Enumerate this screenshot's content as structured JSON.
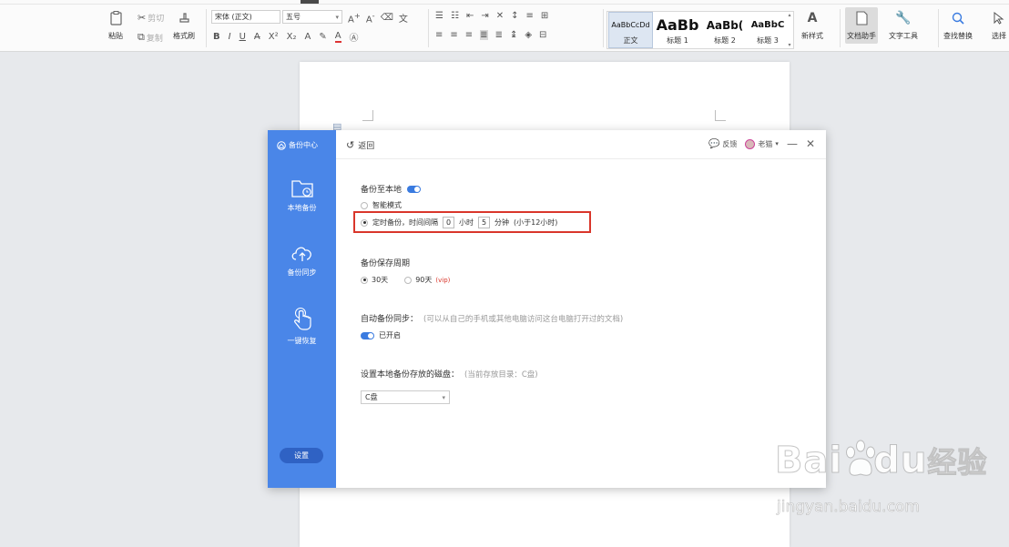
{
  "ribbon": {
    "clipboard": {
      "paste": "粘贴",
      "cut": "剪切",
      "copy": "复制",
      "format_painter": "格式刷"
    },
    "font": {
      "family": "宋体 (正文)",
      "size": "五号"
    },
    "styles": [
      {
        "preview": "AaBbCcDd",
        "name": "正文",
        "selected": true
      },
      {
        "preview": "AaBb",
        "name": "标题 1"
      },
      {
        "preview": "AaBb(",
        "name": "标题 2"
      },
      {
        "preview": "AaBbC",
        "name": "标题 3"
      }
    ],
    "new_style": "新样式",
    "doc_assistant": "文档助手",
    "text_tools": "文字工具",
    "find_replace": "查找替换",
    "select": "选择"
  },
  "dialog": {
    "sidebar": {
      "title": "备份中心",
      "items": [
        {
          "label": "本地备份",
          "icon": "folder-clock-icon"
        },
        {
          "label": "备份同步",
          "icon": "cloud-upload-icon"
        },
        {
          "label": "一键恢复",
          "icon": "hand-pointer-icon"
        }
      ],
      "settings": "设置"
    },
    "back": "返回",
    "feedback": "反馈",
    "user": "老猫",
    "local_backup": {
      "title": "备份至本地",
      "enabled": true,
      "smart_mode": "智能模式",
      "timed_prefix": "定时备份，时间间隔",
      "hours_value": "0",
      "hours_unit": "小时",
      "minutes_value": "5",
      "minutes_unit": "分钟",
      "timed_suffix": "(小于12小时)"
    },
    "retention": {
      "title": "备份保存周期",
      "opt_30": "30天",
      "opt_90": "90天",
      "vip_tag": "(vip)"
    },
    "auto_sync": {
      "title": "自动备份同步：",
      "hint": "(可以从自己的手机或其他电脑访问这台电脑打开过的文档)",
      "status": "已开启"
    },
    "disk": {
      "title": "设置本地备份存放的磁盘：",
      "hint": "(当前存放目录：C盘)",
      "selected": "C盘"
    }
  },
  "watermark": {
    "brand_1": "Bai",
    "brand_2": "du",
    "brand_3": "经验",
    "url": "jingyan.baidu.com"
  },
  "colors": {
    "accent": "#4a86e8",
    "highlight": "#d9362b"
  }
}
